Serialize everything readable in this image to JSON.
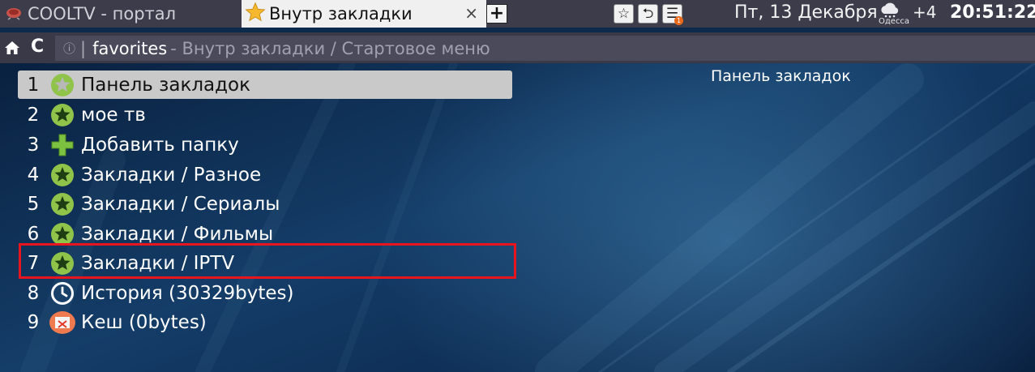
{
  "tabs": [
    {
      "title": "COOLTV - портал",
      "icon": "tv-icon",
      "active": false
    },
    {
      "title": "Внутр закладки",
      "icon": "star-icon",
      "active": true,
      "close": "×"
    }
  ],
  "new_tab_label": "+",
  "toolbar": {
    "star": "☆",
    "back": "⮌",
    "menu": "☰",
    "menu_badge": "1"
  },
  "status": {
    "date": "Пт, 13 Декабря",
    "weather_city": "Одесса",
    "weather_temp": "+4",
    "time": "20:51:22"
  },
  "address": {
    "reload": "C",
    "info": "ⓘ",
    "separator": "|",
    "main": "favorites",
    "path": "- Внутр закладки / Стартовое меню"
  },
  "menu": [
    {
      "num": "1",
      "label": "Панель закладок",
      "icon": "star-icon",
      "selected": true
    },
    {
      "num": "2",
      "label": "мое тв",
      "icon": "star-icon"
    },
    {
      "num": "3",
      "label": "Добавить папку",
      "icon": "plus-icon"
    },
    {
      "num": "4",
      "label": "Закладки / Разное",
      "icon": "star-icon"
    },
    {
      "num": "5",
      "label": "Закладки / Сериалы",
      "icon": "star-icon"
    },
    {
      "num": "6",
      "label": "Закладки / Фильмы",
      "icon": "star-icon"
    },
    {
      "num": "7",
      "label": "Закладки / IPTV",
      "icon": "star-icon",
      "highlighted": true
    },
    {
      "num": "8",
      "label": "История (30329bytes)",
      "icon": "clock-icon"
    },
    {
      "num": "9",
      "label": "Кеш (0bytes)",
      "icon": "cache-clear-icon"
    }
  ],
  "preview": {
    "title": "Панель закладок"
  },
  "colors": {
    "highlight_border": "#e8141e",
    "selected_bg": "#c9c9c9",
    "star_green": "#8fc34a",
    "plus_green": "#7cc240",
    "cache_orange": "#f07a50"
  }
}
